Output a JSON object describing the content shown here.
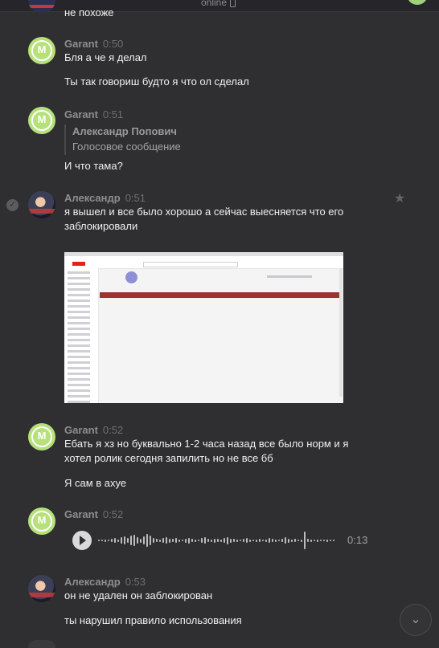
{
  "header": {
    "status": "online"
  },
  "top_partial": {
    "text": "не похоже"
  },
  "messages": [
    {
      "author": "Garant",
      "time": "0:50",
      "lines": [
        "Бля а че я делал",
        "Ты так говориш будто я что ол сделал"
      ]
    },
    {
      "author": "Garant",
      "time": "0:51",
      "reply": {
        "author": "Александр Попович",
        "text": "Голосовое сообщение"
      },
      "lines": [
        "И что тама?"
      ]
    },
    {
      "author": "Александр",
      "time": "0:51",
      "lines": [
        "я вышел и все было хорошо а сейчас выесняется что его",
        "заблокировали"
      ]
    },
    {
      "author": "Garant",
      "time": "0:52",
      "lines": [
        "Ебать я хз но буквально 1-2 часа назад все было норм и я",
        "хотел ролик сегодня запилить но не все бб",
        "Я сам в ахуе"
      ]
    },
    {
      "author": "Garant",
      "time": "0:52",
      "voice": {
        "duration": "0:13",
        "progress": 0
      }
    },
    {
      "author": "Александр",
      "time": "0:53",
      "lines": [
        "он не удален он заблокирован",
        "ты нарушил правило использования"
      ]
    }
  ],
  "icons": {
    "check": "check-circle-icon",
    "star": "star-icon",
    "play": "play-icon",
    "scroll": "chevron-down-icon",
    "phone": "phone-icon"
  },
  "colors": {
    "background": "#2f2f31",
    "avatar_green": "#b5e07a",
    "banner_red": "#9c3330"
  }
}
